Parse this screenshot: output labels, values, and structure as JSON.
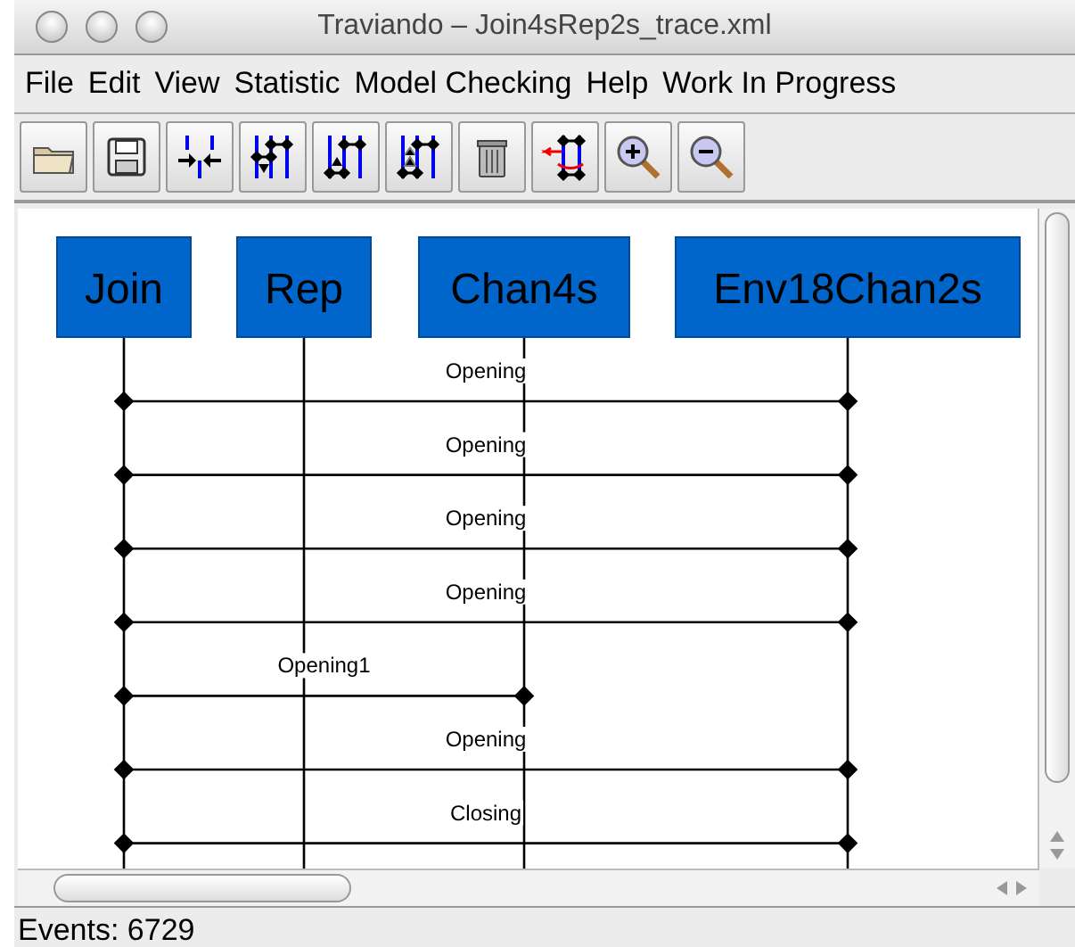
{
  "window": {
    "title": "Traviando – Join4sRep2s_trace.xml"
  },
  "menu": [
    "File",
    "Edit",
    "View",
    "Statistic",
    "Model Checking",
    "Help",
    "Work In Progress"
  ],
  "lifelines": [
    "Join",
    "Rep",
    "Chan4s",
    "Env18Chan2s"
  ],
  "messages": [
    {
      "label": "Opening",
      "kind": "wide"
    },
    {
      "label": "Opening",
      "kind": "wide"
    },
    {
      "label": "Opening",
      "kind": "wide"
    },
    {
      "label": "Opening",
      "kind": "wide"
    },
    {
      "label": "Opening1",
      "kind": "narrow"
    },
    {
      "label": "Opening",
      "kind": "wide"
    },
    {
      "label": "Closing",
      "kind": "wide"
    }
  ],
  "status_bar": "Events: 6729"
}
